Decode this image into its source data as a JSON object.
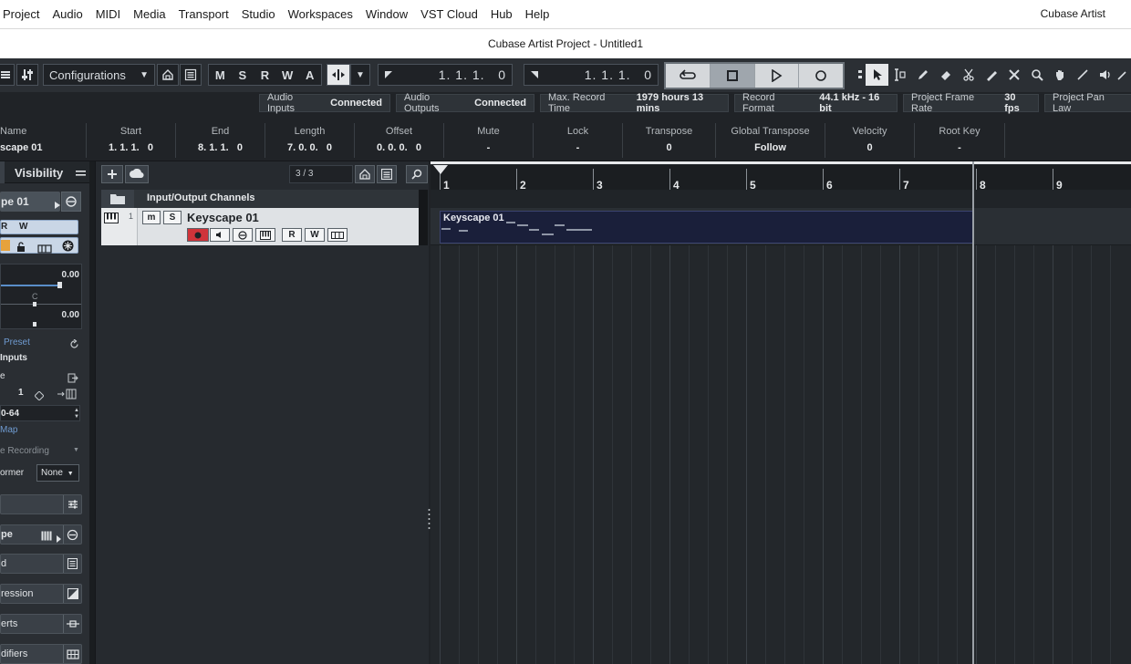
{
  "menubar": {
    "items": [
      "Project",
      "Audio",
      "MIDI",
      "Media",
      "Transport",
      "Studio",
      "Workspaces",
      "Window",
      "VST Cloud",
      "Hub",
      "Help"
    ],
    "app_name": "Cubase Artist"
  },
  "window": {
    "title": "Cubase Artist Project - Untitled1"
  },
  "toolbar": {
    "configurations_label": "Configurations",
    "mode_buttons": [
      "M",
      "S",
      "R",
      "W",
      "A"
    ],
    "left_locator": "1. 1. 1.   0",
    "right_locator": "1. 1. 1.   0"
  },
  "status": {
    "audio_inputs_label": "Audio Inputs",
    "audio_inputs_value": "Connected",
    "audio_outputs_label": "Audio Outputs",
    "audio_outputs_value": "Connected",
    "max_record_label": "Max. Record Time",
    "max_record_value": "1979 hours 13 mins",
    "record_format_label": "Record Format",
    "record_format_value": "44.1 kHz - 16 bit",
    "frame_rate_label": "Project Frame Rate",
    "frame_rate_value": "30 fps",
    "pan_law_label": "Project Pan Law"
  },
  "infoline": {
    "name_label": "Name",
    "name_value": "scape 01",
    "start_label": "Start",
    "start_value": "1. 1. 1.   0",
    "end_label": "End",
    "end_value": "8. 1. 1.   0",
    "length_label": "Length",
    "length_value": "7. 0. 0.   0",
    "offset_label": "Offset",
    "offset_value": "0. 0. 0.   0",
    "mute_label": "Mute",
    "mute_value": "-",
    "lock_label": "Lock",
    "lock_value": "-",
    "transpose_label": "Transpose",
    "transpose_value": "0",
    "global_transpose_label": "Global Transpose",
    "global_transpose_value": "Follow",
    "velocity_label": "Velocity",
    "velocity_value": "0",
    "root_key_label": "Root Key",
    "root_key_value": "-"
  },
  "inspector": {
    "tab_visibility": "Visibility",
    "track_name": "pe 01",
    "volume_value": "0.00",
    "pan_center": "C",
    "pan_value": "0.00",
    "preset_label": "Preset",
    "inputs_label": "Inputs",
    "input_row": "e",
    "channel_value": "1",
    "range_value": "0-64",
    "map_label": "Map",
    "recording_label": "e Recording",
    "transformer_label": "ormer",
    "transformer_value": "None",
    "section_instrument": "pe",
    "section_d": "d",
    "section_expression": "ression",
    "section_inserts": "erts",
    "section_modifiers": "difiers"
  },
  "tracklist": {
    "counter": "3 / 3",
    "folder_name": "Input/Output Channels",
    "track_number": "1",
    "track_name": "Keyscape 01",
    "btn_m": "m",
    "btn_s": "S",
    "btn_r": "R",
    "btn_w": "W"
  },
  "project": {
    "bars": [
      "1",
      "2",
      "3",
      "4",
      "5",
      "6",
      "7",
      "8",
      "9"
    ],
    "event_name": "Keyscape 01"
  },
  "colors": {
    "background": "#202327",
    "event_fill": "#1a1f3a",
    "record_red": "#d0343a"
  }
}
